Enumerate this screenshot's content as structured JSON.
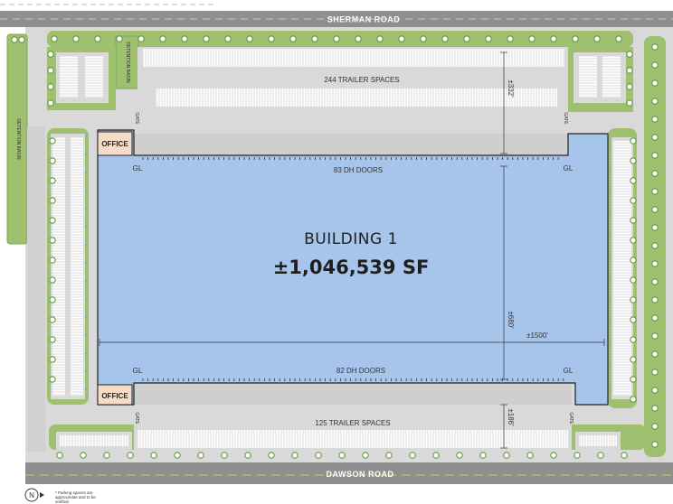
{
  "roads": {
    "north": "SHERMAN ROAD",
    "south": "DAWSON ROAD"
  },
  "building": {
    "name": "BUILDING 1",
    "area": "±1,046,539 SF"
  },
  "docks": {
    "north_doors": "83 DH DOORS",
    "south_doors": "82 DH DOORS"
  },
  "trailers": {
    "north": "244 TRAILER SPACES",
    "south": "125 TRAILER SPACES"
  },
  "dimensions": {
    "north_truck_court": "±332'",
    "building_depth": "±680'",
    "building_length": "±1500'",
    "south_truck_court": "±186'"
  },
  "labels": {
    "office": "OFFICE",
    "grade_level": "GL",
    "gate": "GATE",
    "detention_basin": "DETENTION BASIN"
  },
  "compass": {
    "letter": "N"
  },
  "footnote": "* Parking spaces are approximate and to be verified.",
  "colors": {
    "building": "#a7c5eb",
    "landscape": "#9fc06f",
    "tree": "#5f9a3f",
    "asphalt": "#d9d9d9",
    "road": "#8f8f8f",
    "office": "#f6dcc6",
    "dock": "#cfcfcf"
  }
}
